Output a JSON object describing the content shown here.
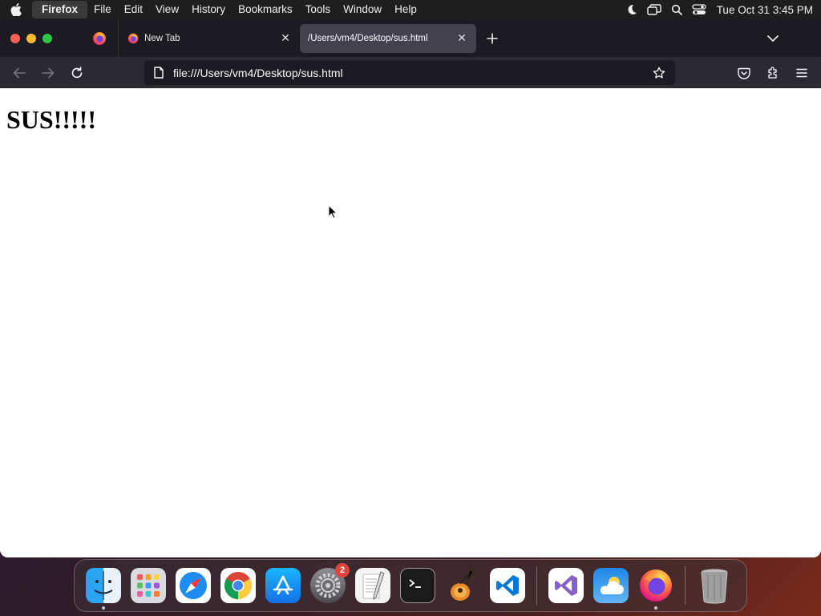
{
  "menubar": {
    "app_name": "Firefox",
    "items": [
      "File",
      "Edit",
      "View",
      "History",
      "Bookmarks",
      "Tools",
      "Window",
      "Help"
    ],
    "clock": "Tue Oct 31  3:45 PM"
  },
  "tabs": [
    {
      "title": "New Tab",
      "icon": "firefox-icon"
    },
    {
      "title": "/Users/vm4/Desktop/sus.html",
      "icon": "none",
      "active": true
    }
  ],
  "urlbar": {
    "url": "file:///Users/vm4/Desktop/sus.html"
  },
  "page": {
    "heading": "SUS!!!!!"
  },
  "dock": {
    "apps": [
      "finder",
      "launchpad",
      "safari",
      "chrome",
      "app-store",
      "system-settings",
      "textedit",
      "terminal",
      "garageband",
      "vscode",
      "visual-studio",
      "weather",
      "firefox",
      "trash"
    ],
    "settings_badge": "2"
  },
  "colors": {
    "tabbar": "#1c1b22",
    "navbar": "#2b2a33",
    "active_tab": "#42414d"
  }
}
